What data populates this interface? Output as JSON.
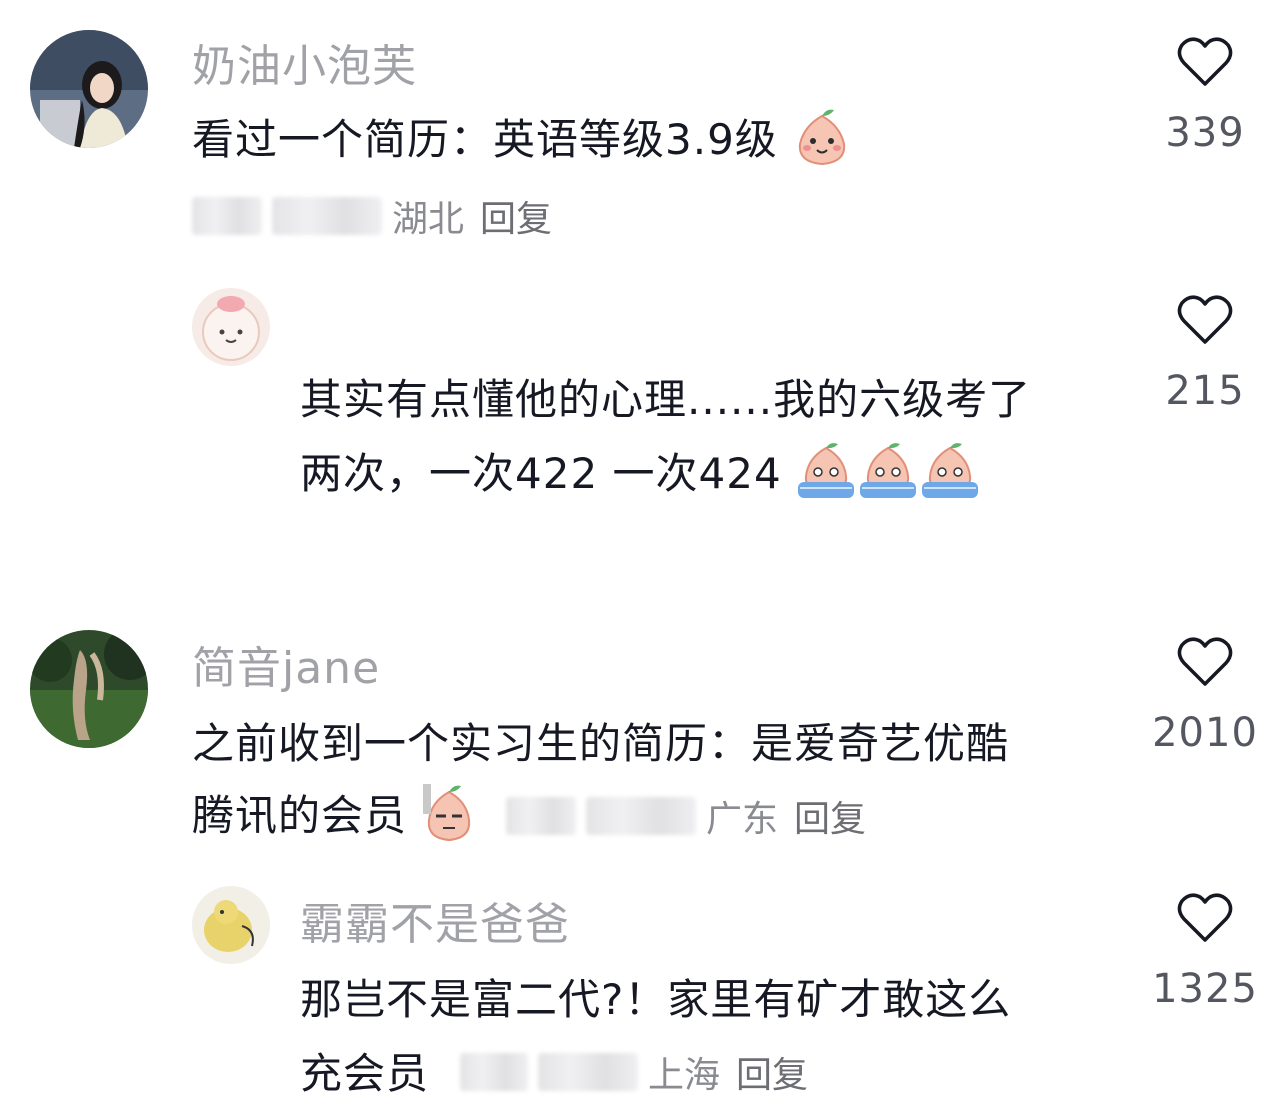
{
  "comments": [
    {
      "username": "奶油小泡芙",
      "text_lines": [
        "看过一个简历：英语等级3.9级"
      ],
      "location": "湖北",
      "reply_label": "回复",
      "likes": "339",
      "emoji": "peach-smile-icon"
    },
    {
      "username": "",
      "text_lines": [
        "其实有点懂他的心理......我的六级考了",
        "两次，一次422 一次424"
      ],
      "likes": "215",
      "emoji": "peach-crying-icon"
    },
    {
      "username": "简音jane",
      "text_lines": [
        "之前收到一个实习生的简历：是爱奇艺优酷",
        "腾讯的会员"
      ],
      "location": "广东",
      "reply_label": "回复",
      "likes": "2010",
      "emoji": "peach-speechless-icon"
    },
    {
      "username": "霸霸不是爸爸",
      "text_lines": [
        "那岂不是富二代?！家里有矿才敢这么",
        "充会员"
      ],
      "location": "上海",
      "reply_label": "回复",
      "likes": "1325"
    }
  ],
  "colors": {
    "text": "#161823",
    "username": "#a1a2a7",
    "meta": "#8a8b91",
    "heart": "#161823"
  }
}
